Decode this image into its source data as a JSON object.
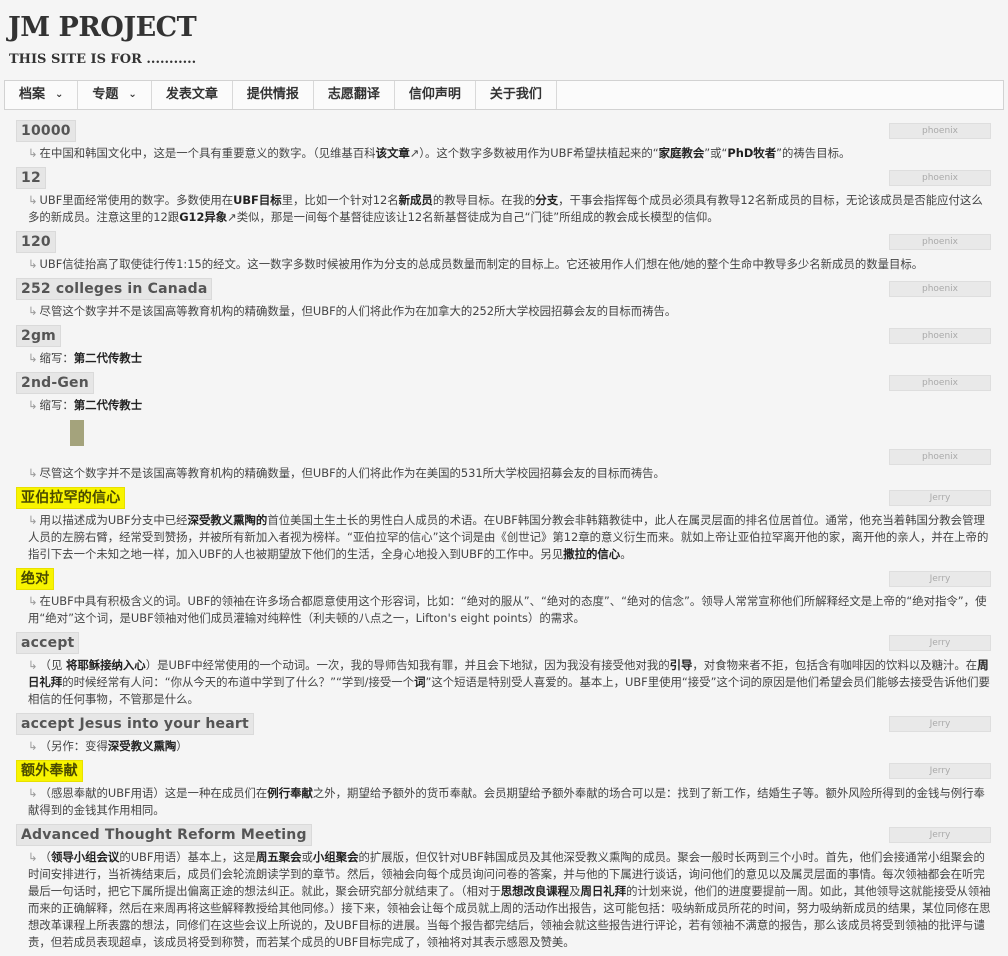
{
  "site": {
    "title": "JM PROJECT",
    "description": "THIS SITE IS FOR ..........."
  },
  "nav": [
    {
      "label": "档案",
      "dropdown": true
    },
    {
      "label": "专题",
      "dropdown": true
    },
    {
      "label": "发表文章"
    },
    {
      "label": "提供情报"
    },
    {
      "label": "志愿翻译"
    },
    {
      "label": "信仰声明"
    },
    {
      "label": "关于我们"
    }
  ],
  "entries": [
    {
      "term": "10000",
      "author": "phoenix",
      "highlight": false,
      "html": "<span class=\"arr\">↳</span>在中国和韩国文化中，这是一个具有重要意义的数字。（见维基百科<b>该文章</b>↗）。这个数字多数被用作为UBF希望扶植起来的“<b>家庭教会</b>”或“<b>PhD牧者</b>”的祷告目标。"
    },
    {
      "term": "12",
      "author": "phoenix",
      "highlight": false,
      "html": "<span class=\"arr\">↳</span>UBF里面经常使用的数字。多数使用在<b>UBF目标</b>里，比如一个针对12名<b>新成员</b>的教导目标。在我的<b>分支</b>，干事会指挥每个成员必须具有教导12名新成员的目标，无论该成员是否能应付这么多的新成员。注意这里的12跟<b>G12异象</b>↗类似，那是一间每个基督徒应该让12名新基督徒成为自己“门徒”所组成的教会成长模型的信仰。"
    },
    {
      "term": "120",
      "author": "phoenix",
      "highlight": false,
      "html": "<span class=\"arr\">↳</span>UBF信徒抬高了取使徒行传1:15的经文。这一数字多数时候被用作为分支的总成员数量而制定的目标上。它还被用作人们想在他/她的整个生命中教导多少名新成员的数量目标。"
    },
    {
      "term": "252 colleges in Canada",
      "author": "phoenix",
      "highlight": false,
      "html": "<span class=\"arr\">↳</span>尽管这个数字并不是该国高等教育机构的精确数量，但UBF的人们将此作为在加拿大的252所大学校园招募会友的目标而祷告。"
    },
    {
      "term": "2gm",
      "author": "phoenix",
      "highlight": false,
      "html": "<span class=\"arr\">↳</span>缩写：<b>第二代传教士</b>"
    },
    {
      "term": "2nd-Gen",
      "author": "phoenix",
      "highlight": false,
      "html": "<span class=\"arr\">↳</span>缩写：<b>第二代传教士</b>"
    },
    {
      "term": "",
      "author": "phoenix",
      "highlight": false,
      "thumb": true,
      "html": "<span class=\"arr\">↳</span>尽管这个数字并不是该国高等教育机构的精确数量，但UBF的人们将此作为在美国的531所大学校园招募会友的目标而祷告。"
    },
    {
      "term": "亚伯拉罕的信心",
      "author": "Jerry",
      "highlight": true,
      "html": "<span class=\"arr\">↳</span>用以描述成为UBF分支中已经<b>深受教义熏陶的</b>首位美国土生土长的男性白人成员的术语。在UBF韩国分教会非韩籍教徒中，此人在属灵层面的排名位居首位。通常，他充当着韩国分教会管理人员的左膀右臂，经常受到赞扬，并被所有新加入者视为榜样。“亚伯拉罕的信心”这个词是由《创世记》第12章的意义衍生而来。就如上帝让亚伯拉罕离开他的家，离开他的亲人，并在上帝的指引下去一个未知之地一样，加入UBF的人也被期望放下他们的生活，全身心地投入到UBF的工作中。另见<b>撒拉的信心</b>。"
    },
    {
      "term": "绝对",
      "author": "Jerry",
      "highlight": true,
      "html": "<span class=\"arr\">↳</span>在UBF中具有积极含义的词。UBF的领袖在许多场合都愿意使用这个形容词，比如：“绝对的服从”、“绝对的态度”、“绝对的信念”。领导人常常宣称他们所解释经文是上帝的“绝对指令”，使用“绝对”这个词，是UBF领袖对他们成员灌输对纯粹性（利夫顿的八点之一，Lifton's eight points）的需求。"
    },
    {
      "term": "accept",
      "author": "Jerry",
      "highlight": false,
      "html": "<span class=\"arr\">↳</span>（见 <b>将耶稣接纳入心</b>）是UBF中经常使用的一个动词。一次，我的导师告知我有罪，并且会下地狱，因为我没有接受他对我的<b>引导</b>，对食物来者不拒，包括含有咖啡因的饮料以及糖汁。在<b>周日礼拜</b>的时候经常有人问：“你从今天的布道中学到了什么？”“学到/接受一个<b>词</b>”这个短语是特别受人喜爱的。基本上，UBF里使用“接受”这个词的原因是他们希望会员们能够去接受告诉他们要相信的任何事物，不管那是什么。"
    },
    {
      "term": "accept Jesus into your heart",
      "author": "Jerry",
      "highlight": false,
      "html": "<span class=\"arr\">↳</span>（另作：变得<b>深受教义熏陶</b>）"
    },
    {
      "term": "额外奉献",
      "author": "Jerry",
      "highlight": true,
      "html": "<span class=\"arr\">↳</span>（感恩奉献的UBF用语）这是一种在成员们在<b>例行奉献</b>之外，期望给予额外的货币奉献。会员期望给予额外奉献的场合可以是：找到了新工作，结婚生子等。额外风险所得到的金钱与例行奉献得到的金钱其作用相同。"
    },
    {
      "term": "Advanced Thought Reform Meeting",
      "author": "Jerry",
      "highlight": false,
      "html": "<span class=\"arr\">↳</span>（<b>领导小组会议</b>的UBF用语）基本上，这是<b>周五聚会</b>或<b>小组聚会</b>的扩展版，但仅针对UBF韩国成员及其他深受教义熏陶的成员。聚会一般时长两到三个小时。首先，他们会接通常小组聚会的时间安排进行，当祈祷结束后，成员们会轮流朗读学到的章节。然后，领袖会向每个成员询问问卷的答案，并与他的下属进行谈话，询问他们的意见以及属灵层面的事情。每次领袖都会在听完最后一句话时，把它下属所提出偏离正途的想法纠正。就此，聚会研究部分就结束了。（相对于<b>思想改良课程</b>及<b>周日礼拜</b>的计划来说，他们的进度要提前一周。如此，其他领导这就能接受从领袖而来的正确解释，然后在来周再将这些解释教授给其他同修。）接下来，领袖会让每个成员就上周的活动作出报告，这可能包括：吸纳新成员所花的时间，努力吸纳新成员的结果，某位同修在思想改革课程上所表露的想法，同修们在这些会议上所说的，及UBF目标的进展。当每个报告都完结后，领袖会就这些报告进行评论，若有领袖不满意的报告，那么该成员将受到领袖的批评与谴责，但若成员表现超卓，该成员将受到称赞，而若某个成员的UBF目标完成了，领袖将对其表示感恩及赞美。"
    }
  ]
}
